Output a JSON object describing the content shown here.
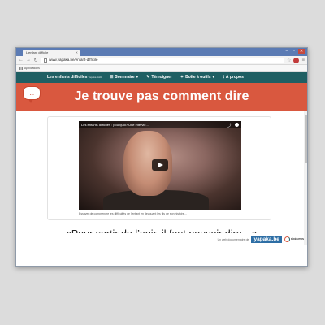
{
  "browser": {
    "tab_title": "L'enfant difficile",
    "url": "www.yapaka.be/enfant-difficile",
    "bookmarks_label": "Applications"
  },
  "nav": {
    "brand": "Les enfants difficiles",
    "brand_small": "Yapaka Asbl",
    "items": [
      "Sommaire",
      "Témoigner",
      "Boîte à outils",
      "À propos"
    ]
  },
  "banner": {
    "title": "Je trouve pas comment dire",
    "bubble": "..."
  },
  "video": {
    "title": "Les enfants difficiles : pourquoi? Une intervie...",
    "caption": "Essayer de comprendre les difficultés de l'enfant en devouant les fils de son histoire..."
  },
  "quote": "«Pour sortir de l’agir, il faut pouvoir dire…»",
  "footer": {
    "text": "Un web documentaire de",
    "logo": "yapaka.be",
    "federation": "FÉDÉRATION"
  }
}
